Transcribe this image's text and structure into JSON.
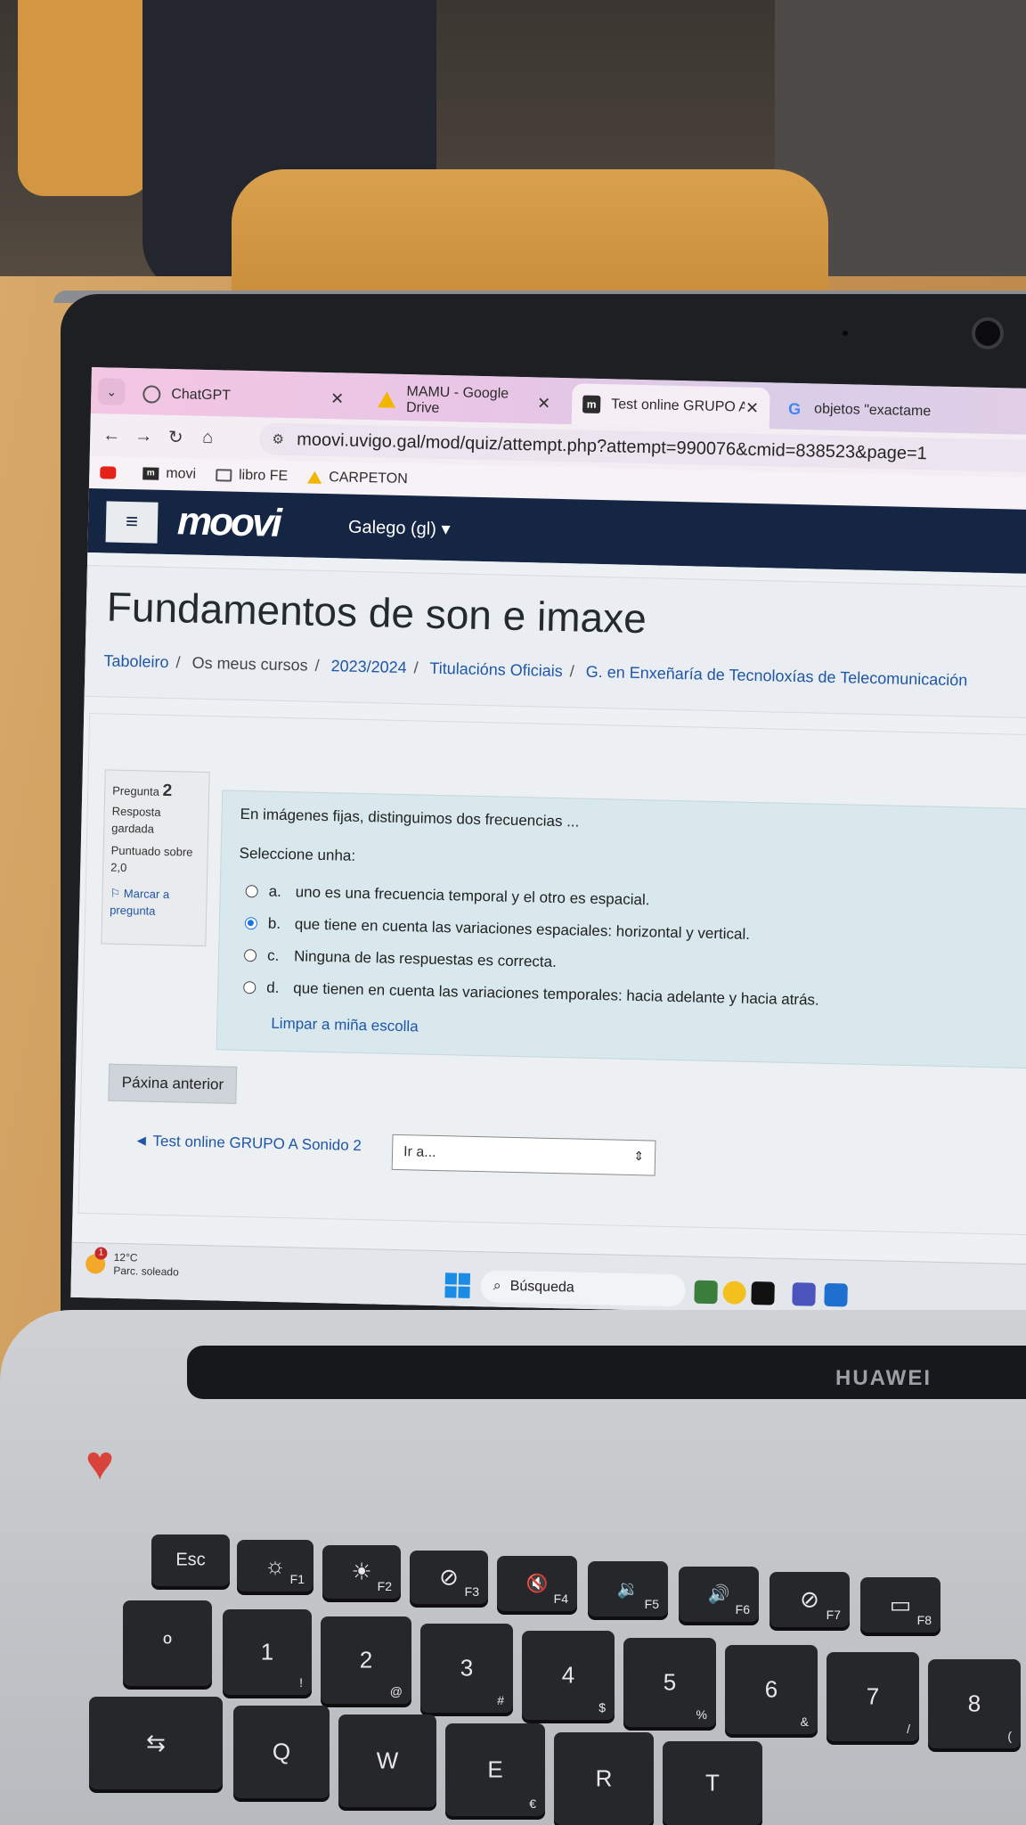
{
  "browser": {
    "tabs": [
      {
        "label": "ChatGPT",
        "icon": "chatgpt-icon"
      },
      {
        "label": "MAMU - Google Drive",
        "icon": "google-drive-icon"
      },
      {
        "label": "Test online GRUPO A Imag",
        "icon": "moovi-icon"
      },
      {
        "label": "objetos \"exactame",
        "icon": "google-icon"
      }
    ],
    "url": "moovi.uvigo.gal/mod/quiz/attempt.php?attempt=990076&cmid=838523&page=1",
    "bookmarks": [
      {
        "label": "",
        "icon": "youtube-icon"
      },
      {
        "label": "movi",
        "icon": "moovi-icon"
      },
      {
        "label": "libro FE",
        "icon": "folder-icon"
      },
      {
        "label": "CARPETON",
        "icon": "google-drive-icon"
      }
    ]
  },
  "navbar": {
    "logo_text": "moovi",
    "language": "Galego (gl) ▾"
  },
  "course": {
    "title": "Fundamentos de son e imaxe",
    "breadcrumb": [
      "Taboleiro",
      "Os meus cursos",
      "2023/2024",
      "Titulacións Oficiais",
      "G. en Enxeñaría de Tecnoloxías de Telecomunicación"
    ]
  },
  "question_info": {
    "label": "Pregunta",
    "number": "2",
    "status": "Resposta gardada",
    "score": "Puntuado sobre 2,0",
    "flag": "Marcar a pregunta"
  },
  "question": {
    "text": "En imágenes fijas, distinguimos dos frecuencias ...",
    "prompt": "Seleccione unha:",
    "options": [
      {
        "letter": "a.",
        "text": "uno es una frecuencia temporal y el otro es espacial.",
        "selected": false
      },
      {
        "letter": "b.",
        "text": "que tiene en cuenta las variaciones espaciales: horizontal y vertical.",
        "selected": true
      },
      {
        "letter": "c.",
        "text": "Ninguna de las respuestas es correcta.",
        "selected": false
      },
      {
        "letter": "d.",
        "text": "que tienen en cuenta las variaciones temporales: hacia adelante y hacia atrás.",
        "selected": false
      }
    ],
    "clear_label": "Limpar a miña escolla"
  },
  "navigation": {
    "prev_page": "Páxina anterior",
    "prev_activity": "◄ Test online GRUPO A Sonido 2",
    "jump_placeholder": "Ir a..."
  },
  "taskbar": {
    "weather_temp": "12°C",
    "weather_desc": "Parc. soleado",
    "weather_badge": "1",
    "search": "Búsqueda"
  },
  "hardware": {
    "brand": "HUAWEI",
    "keys": [
      {
        "main": "Esc",
        "sub": ""
      },
      {
        "main": "☼",
        "sub": "F1"
      },
      {
        "main": "☀",
        "sub": "F2"
      },
      {
        "main": "⊘",
        "sub": "F3"
      },
      {
        "main": "🔇",
        "sub": "F4"
      },
      {
        "main": "🔉",
        "sub": "F5"
      },
      {
        "main": "🔊",
        "sub": "F6"
      },
      {
        "main": "⊘",
        "sub": "F7"
      },
      {
        "main": "▭",
        "sub": "F8"
      },
      {
        "main": "1",
        "sub": "!"
      },
      {
        "main": "2",
        "sub": "@"
      },
      {
        "main": "3",
        "sub": "#"
      },
      {
        "main": "4",
        "sub": "$"
      },
      {
        "main": "5",
        "sub": "%"
      },
      {
        "main": "6",
        "sub": "&"
      },
      {
        "main": "7",
        "sub": "/"
      },
      {
        "main": "8",
        "sub": "("
      },
      {
        "main": "Q",
        "sub": ""
      },
      {
        "main": "W",
        "sub": ""
      },
      {
        "main": "E",
        "sub": "€"
      },
      {
        "main": "R",
        "sub": ""
      },
      {
        "main": "T",
        "sub": ""
      }
    ]
  }
}
